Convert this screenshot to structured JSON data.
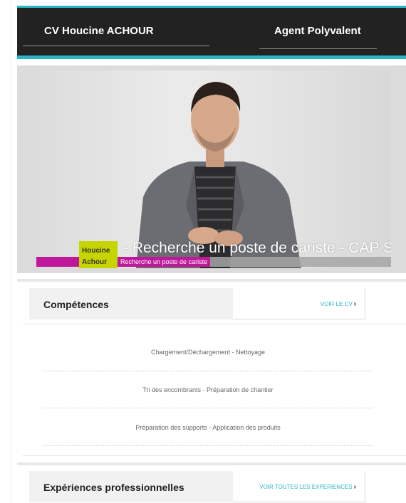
{
  "header": {
    "cv_name": "CV Houcine ACHOUR",
    "job_title": "Agent Polyvalent"
  },
  "video": {
    "overlay_title": "- Recherche un poste de cariste - CAP Serr",
    "badge_first_name": "Houcine",
    "badge_last_name": "Achour",
    "tag_text": "Recherche un poste de cariste"
  },
  "skills_section": {
    "title": "Compétences",
    "link_label": "VOIR LE CV",
    "items": [
      "Chargement/Déchargement - Nettoyage",
      "Tri des encombrants - Préparation de chantier",
      "Préparation des supports - Application des produits"
    ]
  },
  "experience_section": {
    "title": "Expériences professionnelles",
    "link_label": "VOIR TOUTES LES EXPERIENCES"
  },
  "colors": {
    "accent": "#2ab5c7",
    "header_bg": "#222222",
    "badge": "#c6d400",
    "magenta": "#c0189a"
  }
}
